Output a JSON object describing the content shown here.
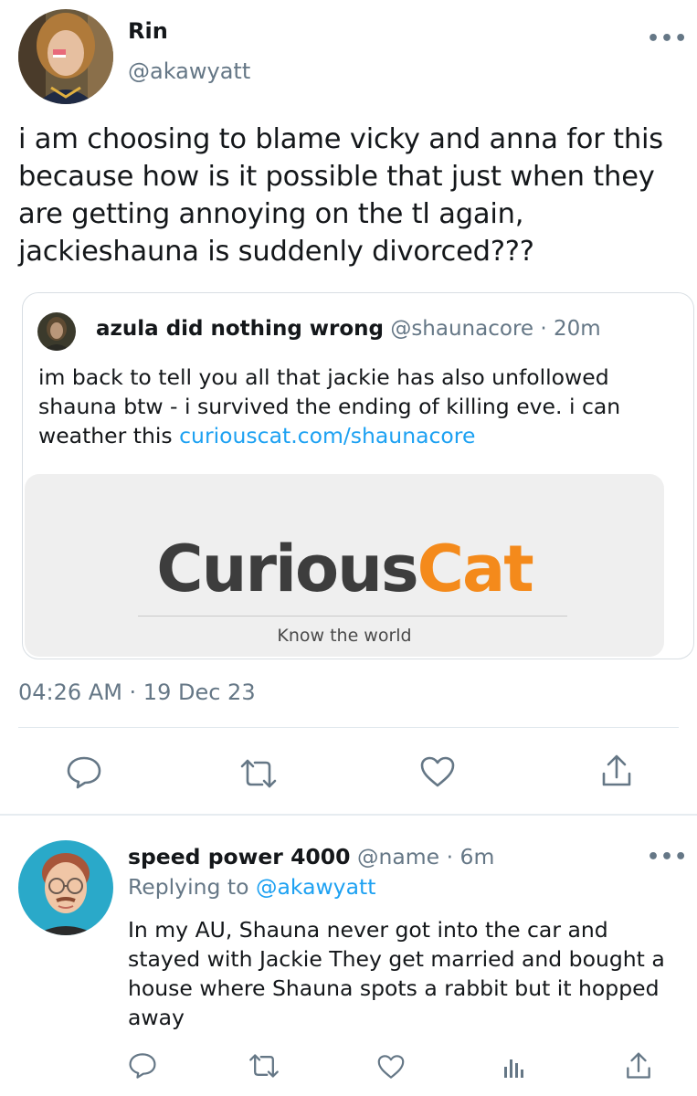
{
  "main_tweet": {
    "display_name": "Rin",
    "handle": "@akawyatt",
    "more_icon": "more-horizontal-icon",
    "text": "i am choosing to blame vicky and anna for this because how is it possible that just when they are getting annoying on the tl again, jackieshauna is suddenly divorced???",
    "timestamp": "04:26 AM · 19 Dec 23"
  },
  "quoted_tweet": {
    "display_name": "azula did nothing wrong",
    "handle_time": "@shaunacore · 20m",
    "text": "im back to tell you all that jackie has also unfollowed shauna btw - i survived the ending of killing eve. i can weather this ",
    "link": "curiouscat.com/shaunacore",
    "card": {
      "logo_part1": "Curious",
      "logo_part2": "Cat",
      "tagline": "Know the world",
      "brand_orange": "#f48a1b",
      "brand_dark": "#3d3d3d"
    }
  },
  "main_actions": [
    "reply-icon",
    "retweet-icon",
    "like-icon",
    "share-icon"
  ],
  "reply_tweet": {
    "display_name": "speed power 4000",
    "handle_time": "@name · 6m",
    "replying_prefix": "Replying to ",
    "replying_to": "@akawyatt",
    "text": "In my AU, Shauna never got into the car and stayed with Jackie They get married and bought a house where Shauna spots a rabbit but it hopped away"
  },
  "reply_actions": [
    "reply-icon",
    "retweet-icon",
    "like-icon",
    "analytics-icon",
    "share-icon"
  ],
  "colors": {
    "text": "#14171a",
    "secondary": "#657786",
    "link": "#1da1f2",
    "divider": "#e1e8ed"
  }
}
